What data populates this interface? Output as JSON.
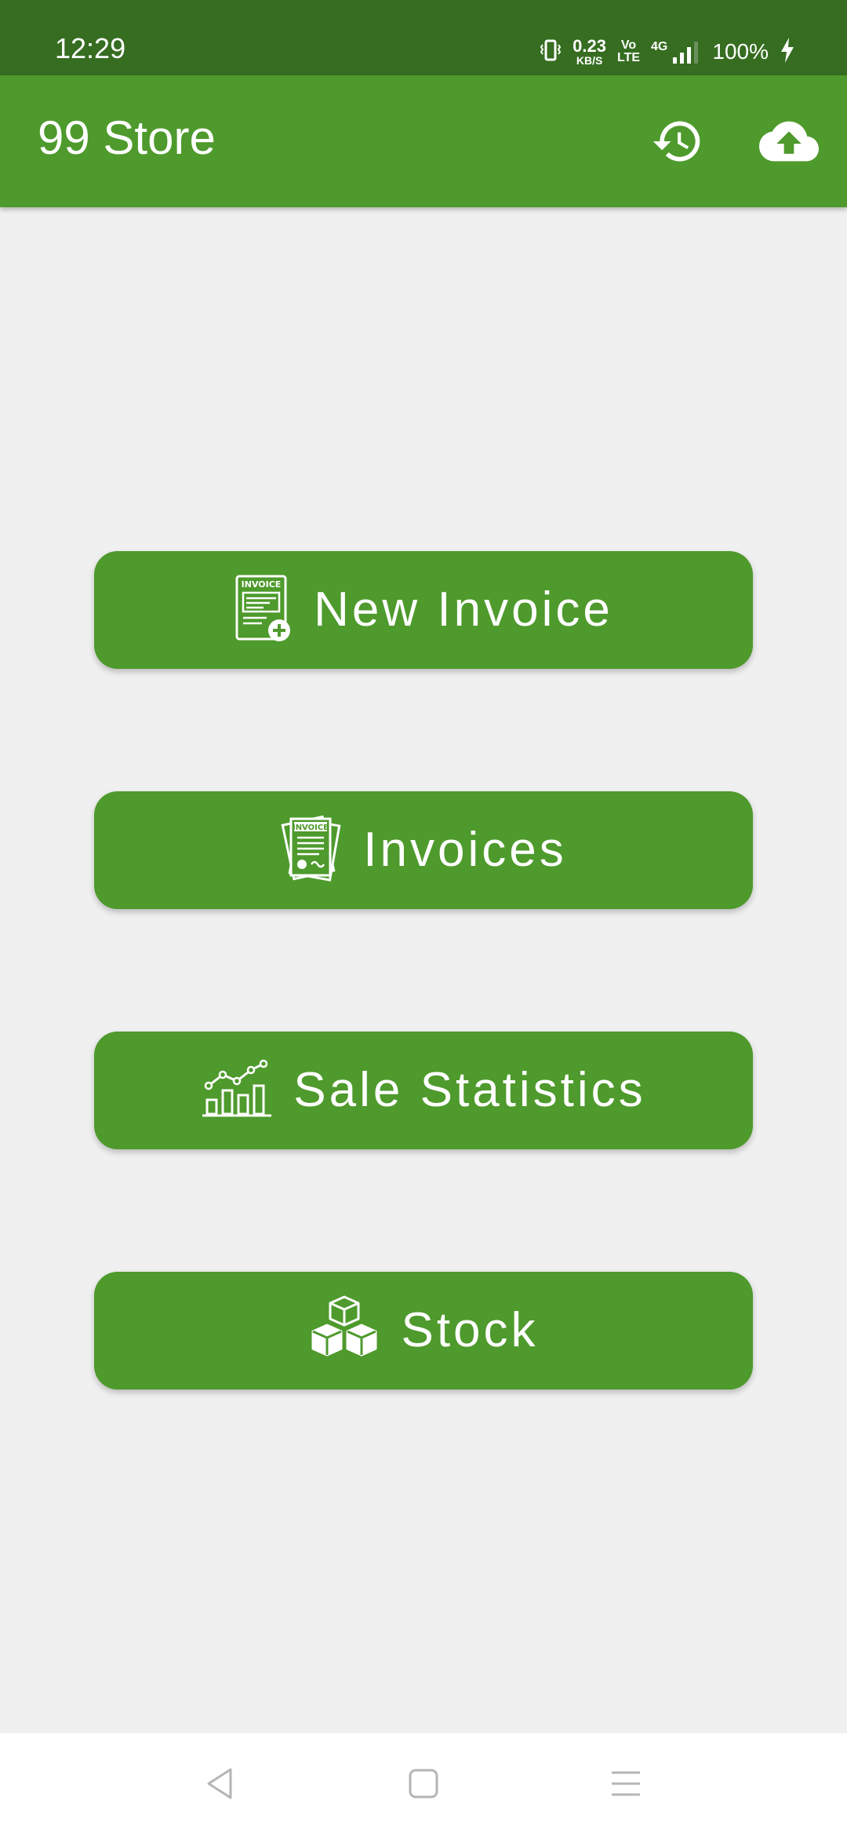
{
  "status_bar": {
    "time": "12:29",
    "net_speed_value": "0.23",
    "net_speed_unit": "KB/S",
    "volte_top": "Vo",
    "volte_bottom": "LTE",
    "network": "4G",
    "battery": "100%"
  },
  "app_bar": {
    "title": "99 Store",
    "history_icon": "history-icon",
    "upload_icon": "cloud-upload-icon"
  },
  "menu": [
    {
      "label": "New Invoice",
      "icon": "new-invoice-icon",
      "icon_text": "INVOICE"
    },
    {
      "label": "Invoices",
      "icon": "invoices-icon",
      "icon_text": "INVOICE"
    },
    {
      "label": "Sale Statistics",
      "icon": "sale-statistics-icon"
    },
    {
      "label": "Stock",
      "icon": "stock-boxes-icon"
    }
  ],
  "nav_bar": {
    "back_icon": "back-icon",
    "home_icon": "home-icon",
    "recents_icon": "recents-icon"
  },
  "colors": {
    "status_bar": "#366d21",
    "primary": "#4e9a2c",
    "background": "#f0f0f0",
    "nav_icon": "#b5b5b5"
  }
}
